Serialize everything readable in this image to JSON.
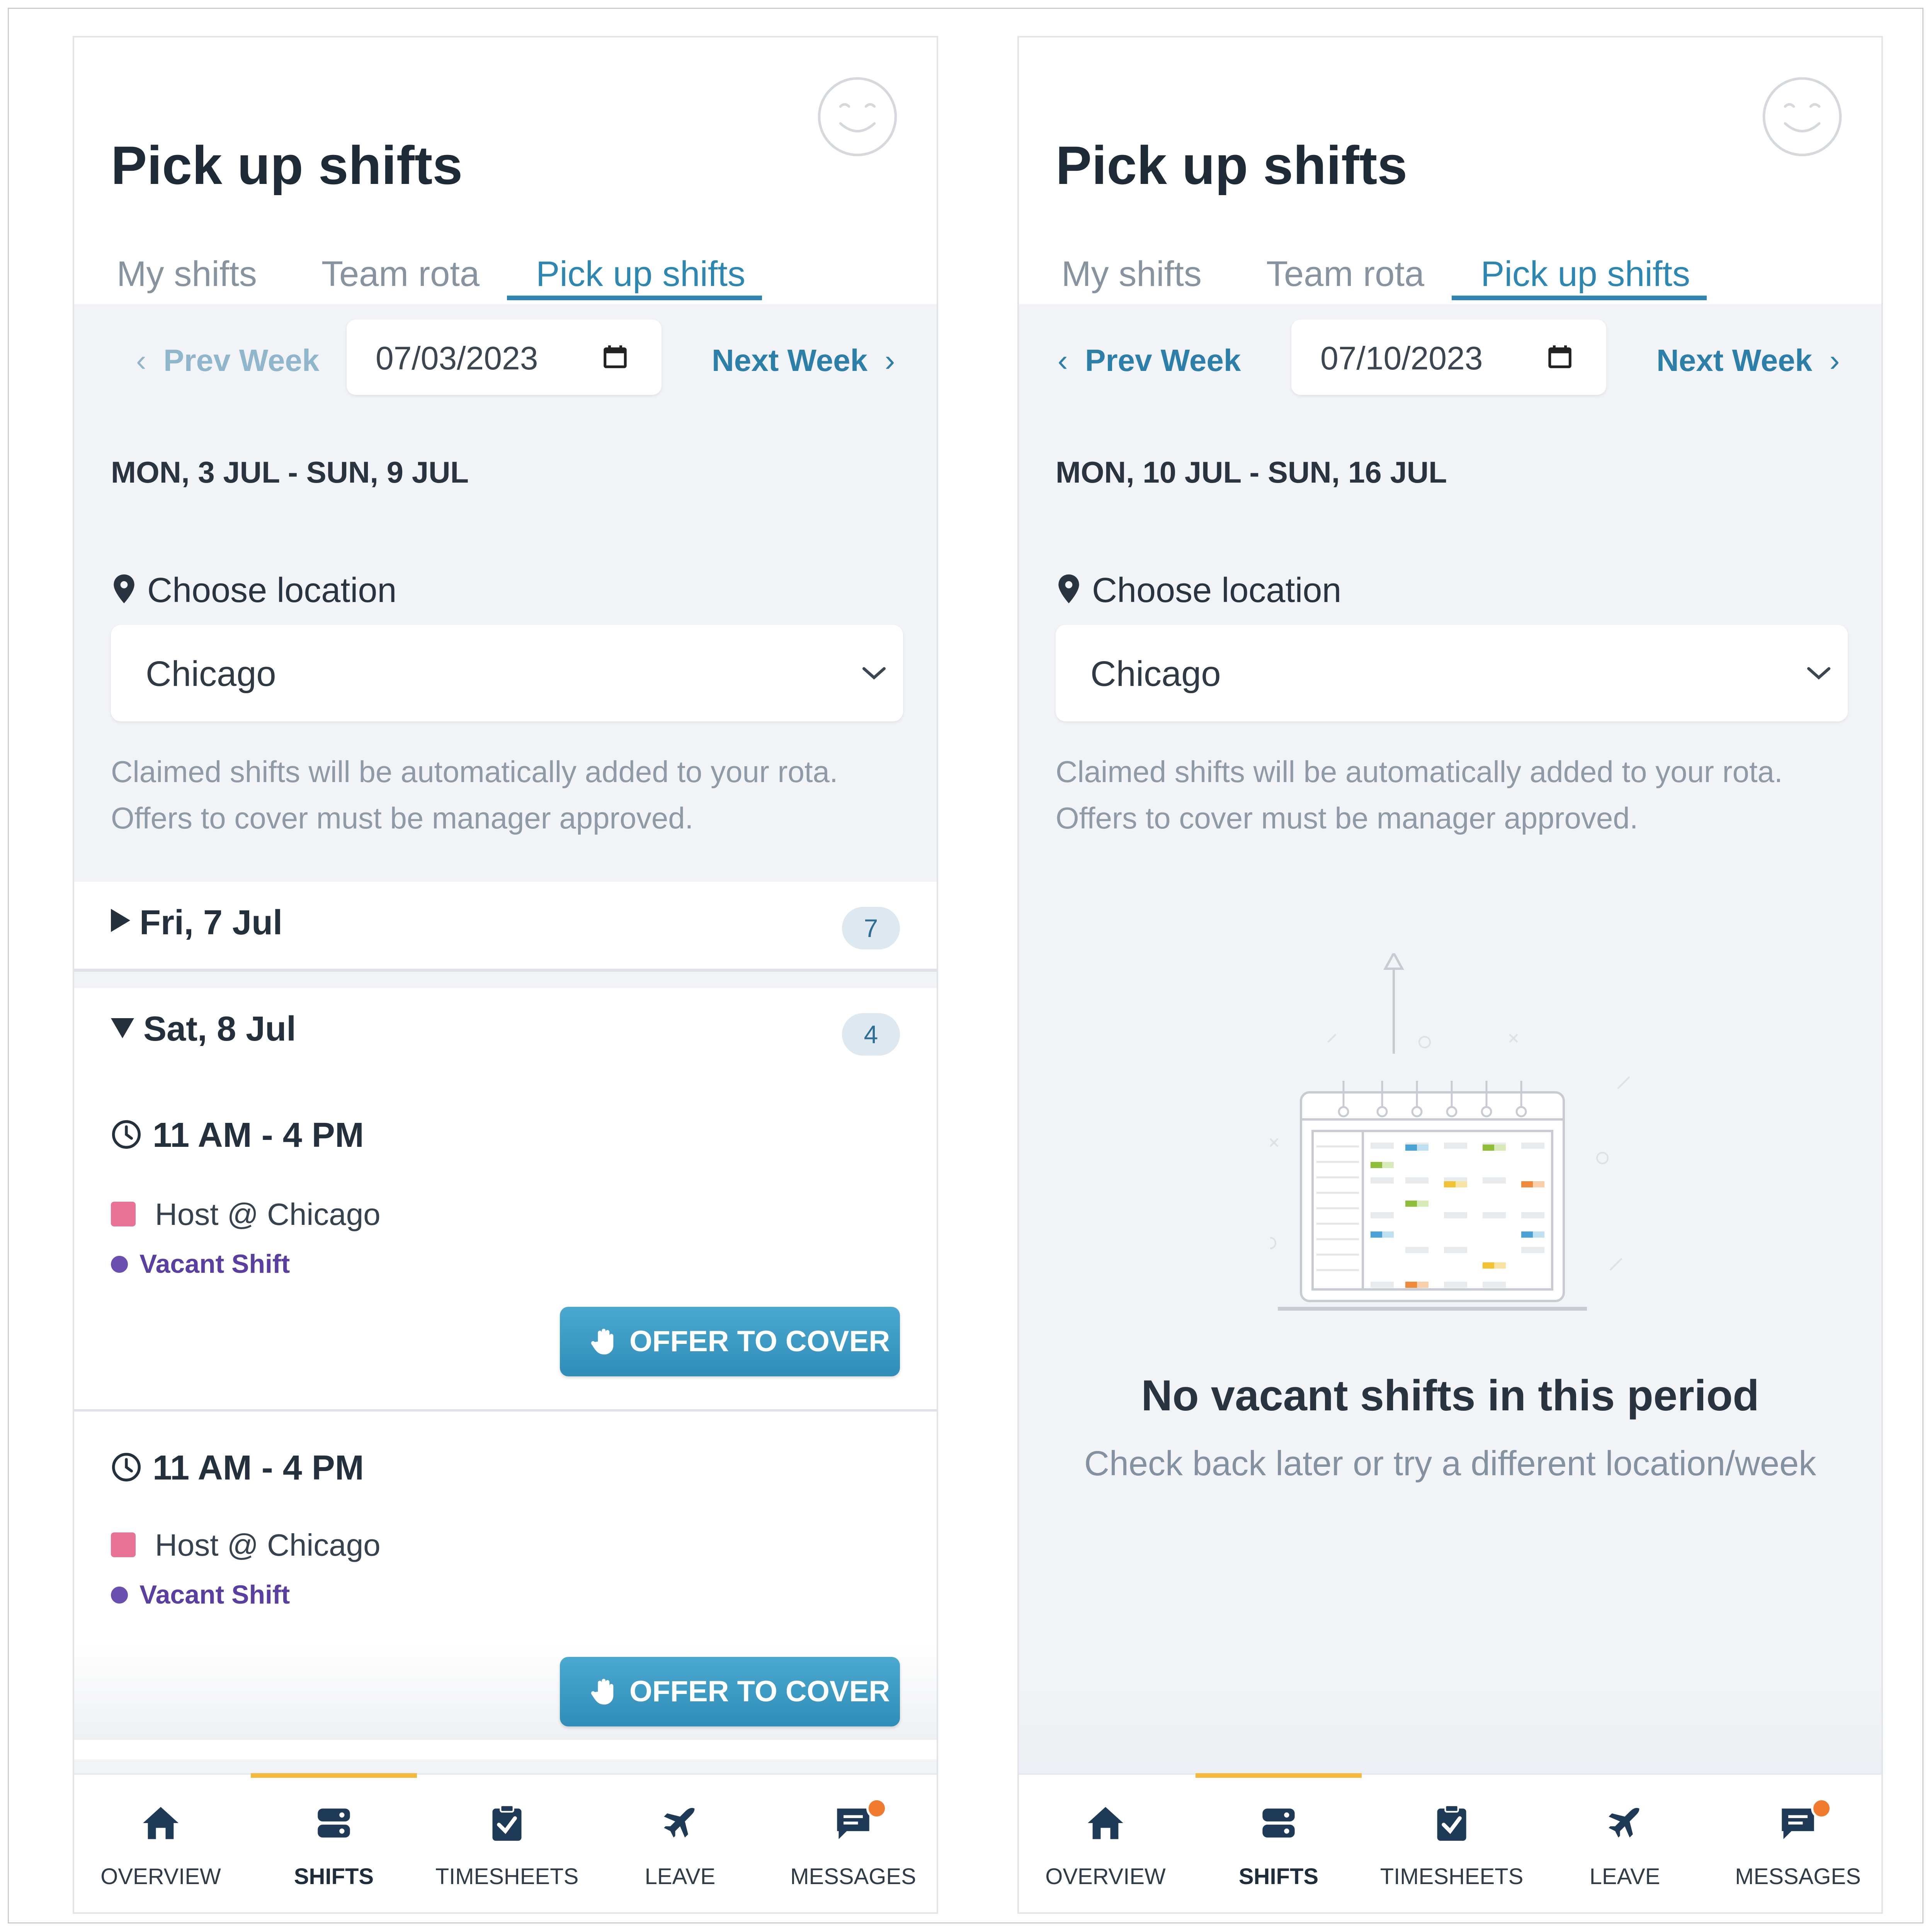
{
  "left": {
    "title": "Pick up shifts",
    "tabs": [
      "My shifts",
      "Team rota",
      "Pick up shifts"
    ],
    "prev_week": "Prev Week",
    "next_week": "Next Week",
    "date_value": "07/03/2023",
    "range": "MON, 3 JUL - SUN, 9 JUL",
    "location_label": "Choose location",
    "location_value": "Chicago",
    "info_line1": "Claimed shifts will be automatically added to your rota.",
    "info_line2": "Offers to cover must be manager approved.",
    "days": [
      {
        "label": "Fri, 7 Jul",
        "count": "7",
        "expanded": false
      },
      {
        "label": "Sat, 8 Jul",
        "count": "4",
        "expanded": true
      }
    ],
    "shifts": [
      {
        "time": "11 AM - 4 PM",
        "role": "Host @ Chicago",
        "status": "Vacant Shift",
        "action": "OFFER TO COVER"
      },
      {
        "time": "11 AM - 4 PM",
        "role": "Host @ Chicago",
        "status": "Vacant Shift",
        "action": "OFFER TO COVER"
      }
    ]
  },
  "right": {
    "title": "Pick up shifts",
    "tabs": [
      "My shifts",
      "Team rota",
      "Pick up shifts"
    ],
    "prev_week": "Prev Week",
    "next_week": "Next Week",
    "date_value": "07/10/2023",
    "range": "MON, 10 JUL - SUN, 16 JUL",
    "location_label": "Choose location",
    "location_value": "Chicago",
    "info_line1": "Claimed shifts will be automatically added to your rota.",
    "info_line2": "Offers to cover must be manager approved.",
    "empty_title": "No vacant shifts in this period",
    "empty_sub": "Check back later or try a different location/week"
  },
  "nav": [
    {
      "label": "OVERVIEW",
      "icon": "home-icon"
    },
    {
      "label": "SHIFTS",
      "icon": "shifts-icon",
      "active": true
    },
    {
      "label": "TIMESHEETS",
      "icon": "clipboard-check-icon"
    },
    {
      "label": "LEAVE",
      "icon": "airplane-icon"
    },
    {
      "label": "MESSAGES",
      "icon": "message-icon",
      "notification": true
    }
  ],
  "colors": {
    "accent": "#2e87b0",
    "nav_active": "#f5b93e",
    "role_color": "#e87396",
    "vacant_color": "#5b3fa0",
    "notification": "#f07a2e"
  }
}
